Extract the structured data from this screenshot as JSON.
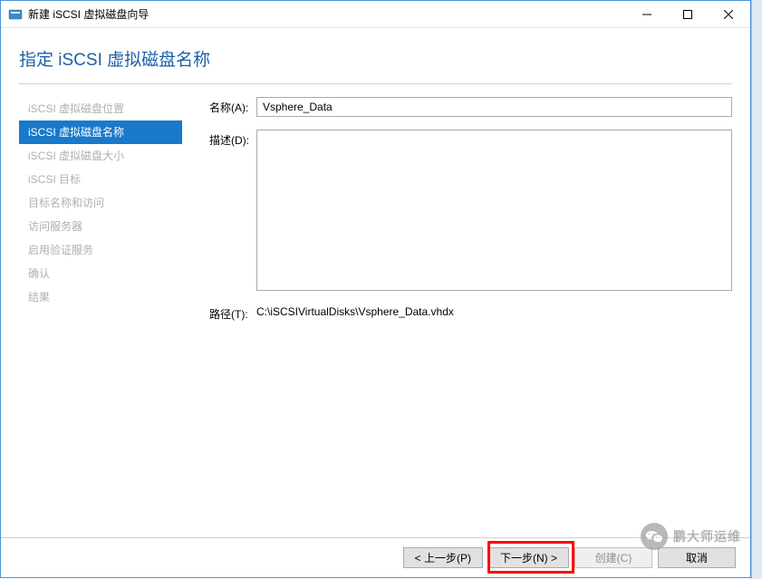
{
  "titlebar": {
    "title": "新建 iSCSI 虚拟磁盘向导"
  },
  "header": {
    "title": "指定 iSCSI 虚拟磁盘名称"
  },
  "sidebar": {
    "items": [
      {
        "label": "iSCSI 虚拟磁盘位置",
        "state": "completed"
      },
      {
        "label": "iSCSI 虚拟磁盘名称",
        "state": "active"
      },
      {
        "label": "iSCSI 虚拟磁盘大小",
        "state": "pending"
      },
      {
        "label": "iSCSI 目标",
        "state": "pending"
      },
      {
        "label": "目标名称和访问",
        "state": "pending"
      },
      {
        "label": "访问服务器",
        "state": "pending"
      },
      {
        "label": "启用验证服务",
        "state": "pending"
      },
      {
        "label": "确认",
        "state": "pending"
      },
      {
        "label": "结果",
        "state": "pending"
      }
    ]
  },
  "form": {
    "name_label": "名称(A):",
    "name_value": "Vsphere_Data",
    "desc_label": "描述(D):",
    "desc_value": "",
    "path_label": "路径(T):",
    "path_value": "C:\\iSCSIVirtualDisks\\Vsphere_Data.vhdx"
  },
  "footer": {
    "previous": "< 上一步(P)",
    "next": "下一步(N) >",
    "create": "创建(C)",
    "cancel": "取消"
  },
  "watermark": {
    "text": "鹏大师运维"
  }
}
